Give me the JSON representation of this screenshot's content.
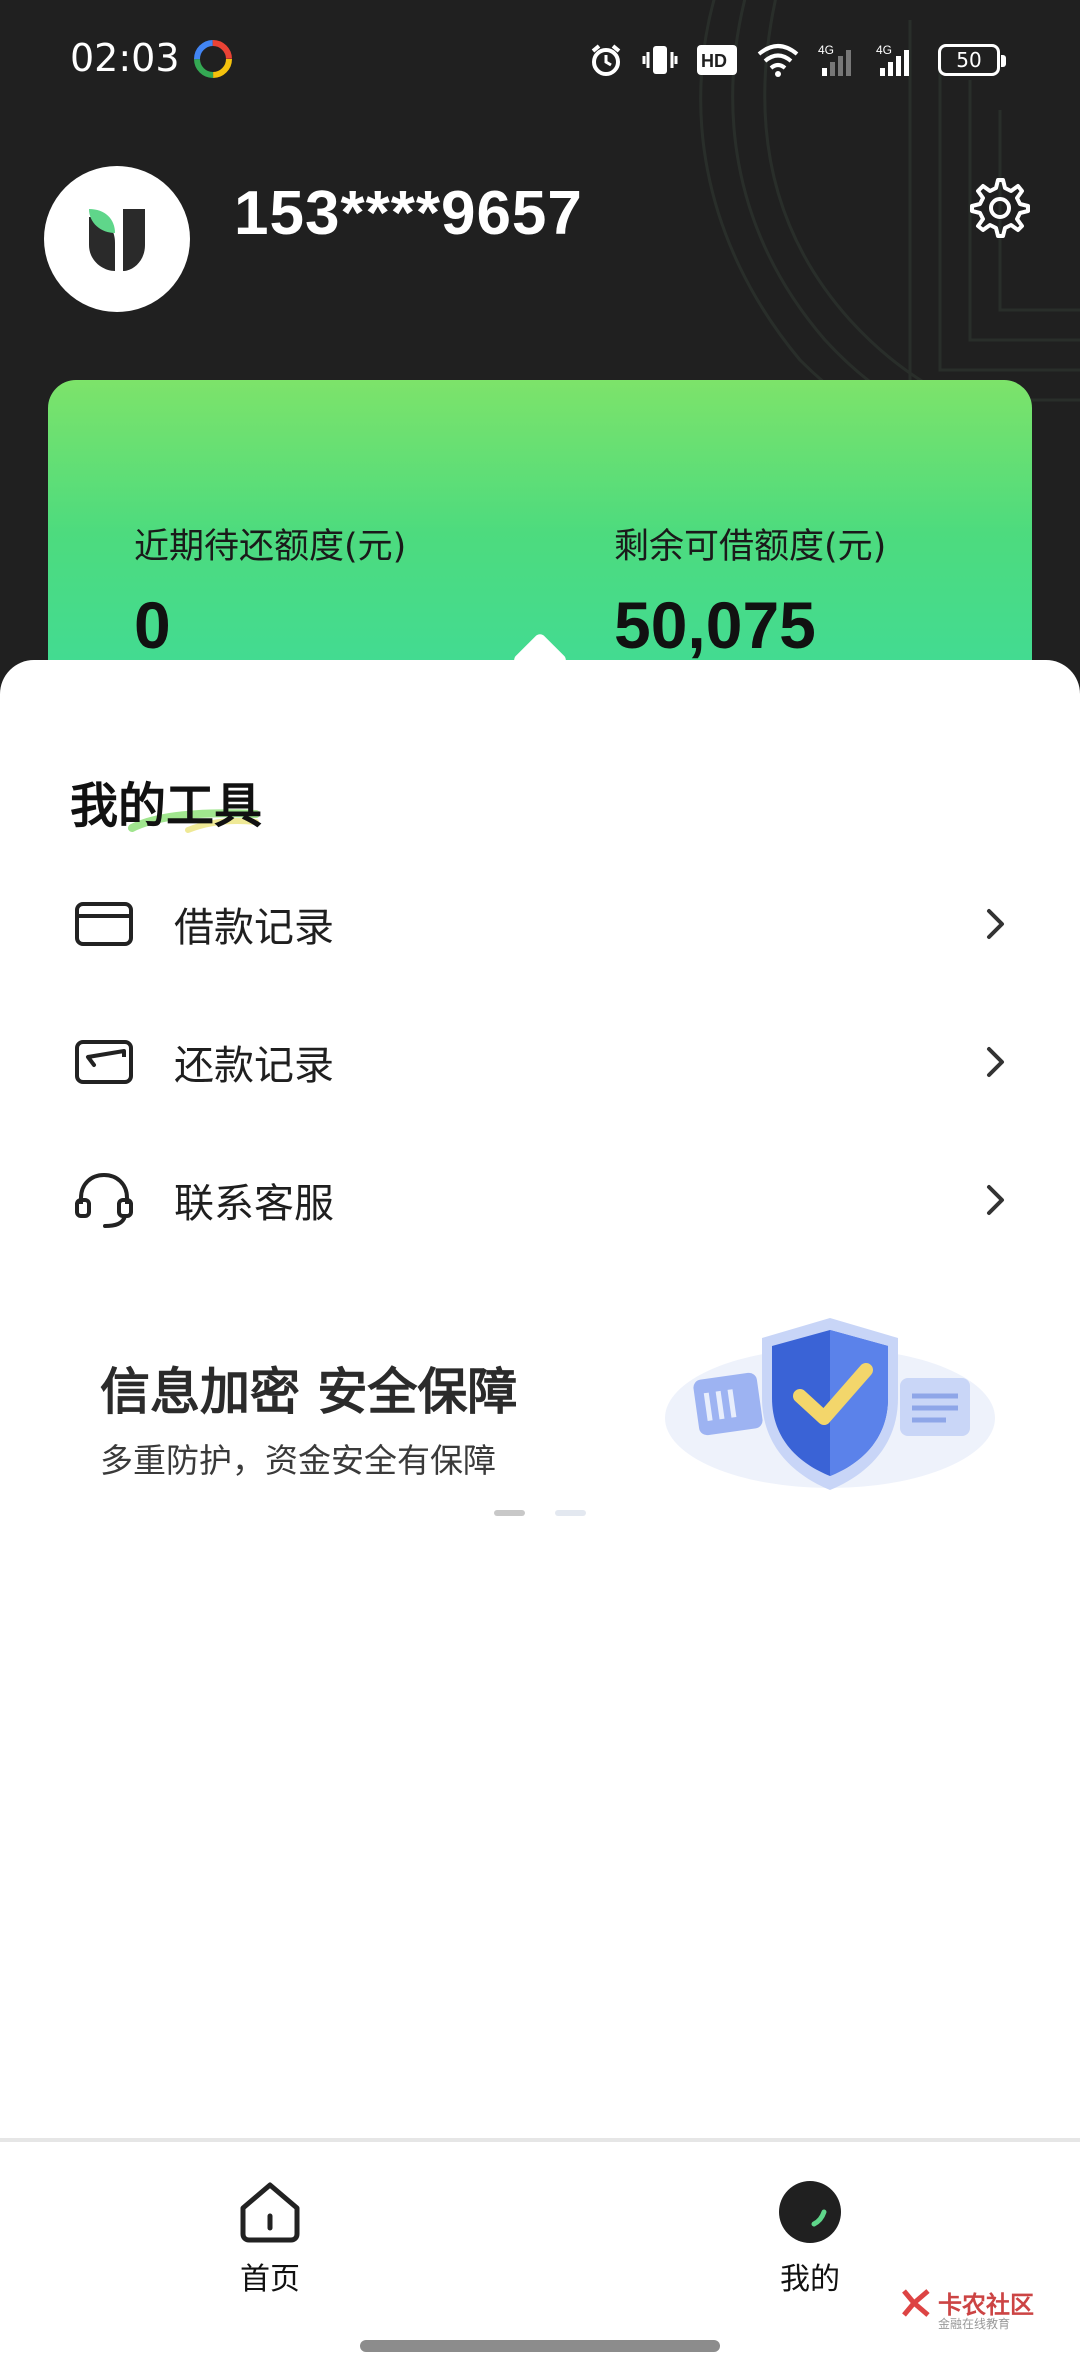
{
  "status_bar": {
    "time": "02:03",
    "battery": "50",
    "icons": [
      "app-icon",
      "alarm-icon",
      "vibrate-icon",
      "hd-icon",
      "wifi-icon",
      "signal-4g-icon",
      "signal-4g-icon",
      "battery-icon"
    ],
    "hd_label": "HD",
    "network_label": "4G"
  },
  "profile": {
    "phone": "153****9657"
  },
  "credit": {
    "upcoming_label": "近期待还额度(元)",
    "upcoming_value": "0",
    "available_label": "剩余可借额度(元)",
    "available_value": "50,075"
  },
  "tools": {
    "title": "我的工具",
    "items": [
      {
        "label": "借款记录",
        "icon": "card-icon"
      },
      {
        "label": "还款记录",
        "icon": "wallet-icon"
      },
      {
        "label": "联系客服",
        "icon": "headset-icon"
      }
    ]
  },
  "banner": {
    "title": "信息加密 安全保障",
    "subtitle": "多重防护，资金安全有保障",
    "icon": "shield-check-icon",
    "page_count": 2,
    "active_page": 1
  },
  "bottom_nav": {
    "items": [
      {
        "label": "首页",
        "icon": "home-icon",
        "active": false
      },
      {
        "label": "我的",
        "icon": "profile-logo-icon",
        "active": true
      }
    ]
  },
  "watermark": {
    "text": "卡农社区",
    "sub": "金融在线教育"
  },
  "colors": {
    "header_bg": "#202020",
    "card_gradient_top": "#7de36a",
    "card_gradient_bottom": "#3edb9a",
    "accent_green": "#3edb9a"
  }
}
